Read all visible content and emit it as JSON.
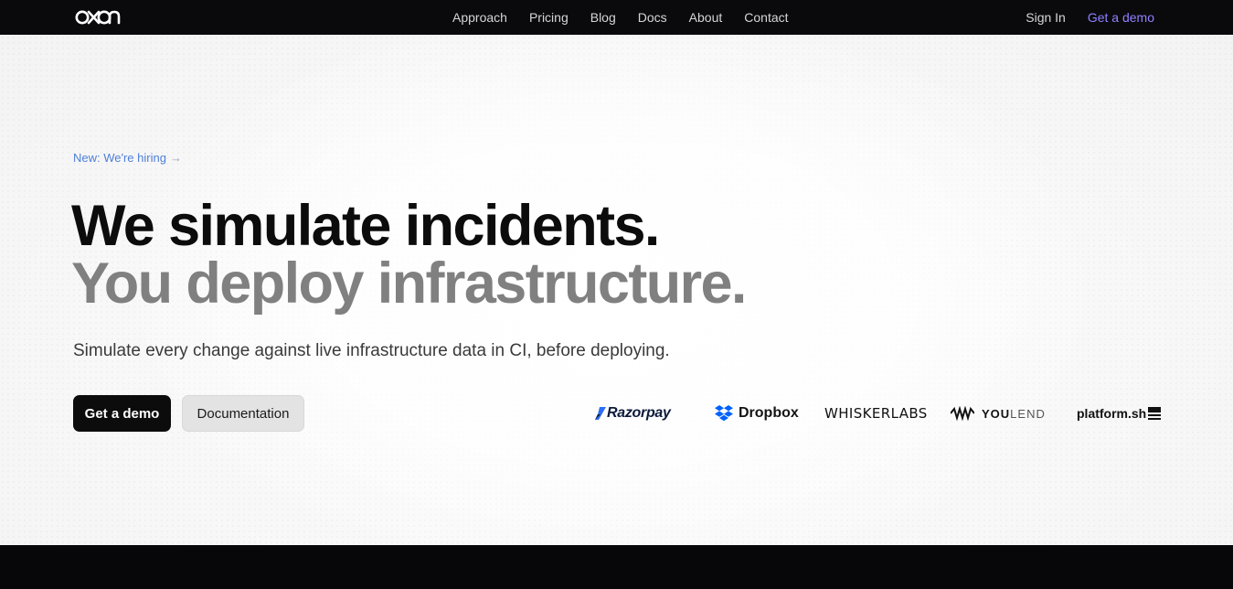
{
  "nav": {
    "logo_icon": "oxo-logo-icon",
    "links": [
      "Approach",
      "Pricing",
      "Blog",
      "Docs",
      "About",
      "Contact"
    ],
    "sign_in": "Sign In",
    "get_demo": "Get a demo",
    "accent_color": "#8f80ff"
  },
  "hero": {
    "announcement": "New: We're hiring",
    "announcement_arrow": "→",
    "headline_line1": "We simulate incidents.",
    "headline_line2": "You deploy infrastructure.",
    "subtitle": "Simulate every change against live infrastructure data in CI, before deploying.",
    "primary_button": "Get a demo",
    "secondary_button": "Documentation"
  },
  "customer_logos": {
    "razorpay": "Razorpay",
    "dropbox": "Dropbox",
    "whiskerlabs": "WHISKERLABS",
    "youlend_you": "YOU",
    "youlend_lend": "LEND",
    "platform": "platform.sh"
  }
}
